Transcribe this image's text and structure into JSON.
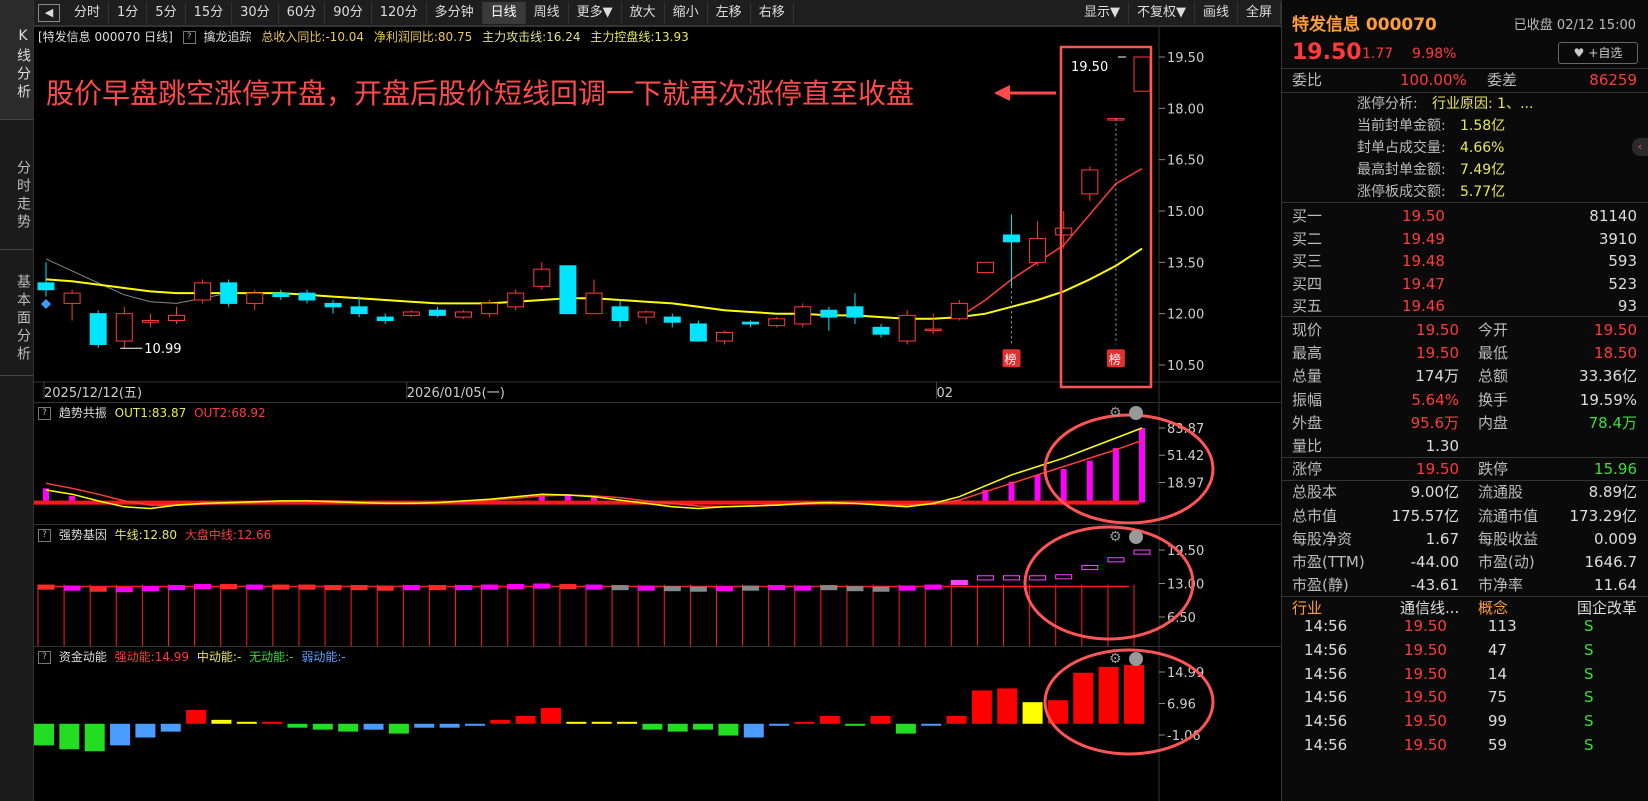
{
  "toolbar": {
    "periods": [
      "分时",
      "1分",
      "5分",
      "15分",
      "30分",
      "60分",
      "90分",
      "120分",
      "多分钟",
      "日线",
      "周线",
      "更多▼",
      "放大",
      "缩小",
      "左移",
      "右移"
    ],
    "right": [
      "显示▼",
      "不复权▼",
      "画线",
      "全屏"
    ]
  },
  "rail": {
    "k": "K线分析",
    "fs": "分时走势",
    "jb": "基本面分析"
  },
  "main_header": {
    "name": "[特发信息 000070 日线]",
    "indicator": "擒龙追踪",
    "f1": "总收入同比:-10.04",
    "f2": "净利润同比:80.75",
    "f3": "主力攻击线:16.24",
    "f4": "主力控盘线:13.93"
  },
  "annotation": {
    "text": "股价早盘跳空涨停开盘，开盘后股价短线回调一下就再次涨停直至收盘",
    "high_label": "19.50",
    "low_label": "10.99",
    "bang": "榜"
  },
  "dates": [
    "2025/12/12(五)",
    "2026/01/05(一)",
    "02"
  ],
  "main_axis": [
    "19.50",
    "18.00",
    "16.50",
    "15.00",
    "13.50",
    "12.00",
    "10.50"
  ],
  "sub1": {
    "name": "趋势共振",
    "out1": "OUT1:83.87",
    "out2": "OUT2:68.92",
    "axis": [
      "83.87",
      "51.42",
      "18.97"
    ]
  },
  "sub2": {
    "name": "强势基因",
    "l1": "牛线:12.80",
    "l2": "大盘中线:12.66",
    "axis": [
      "19.50",
      "13.00",
      "6.50"
    ]
  },
  "sub3": {
    "name": "资金动能",
    "l1": "强动能:14.99",
    "l2": "中动能:-",
    "l3": "无动能:-",
    "l4": "弱动能:-",
    "axis": [
      "14.99",
      "6.96",
      "-1.06"
    ]
  },
  "quote": {
    "title": "特发信息 000070",
    "status": "已收盘 02/12 15:00",
    "price": "19.50",
    "chg": "1.77",
    "pct": "9.98%",
    "addfav": "+自选",
    "weibi_l": "委比",
    "weibi": "100.00%",
    "weicha_l": "委差",
    "weicha": "86259",
    "limit_title": "涨停分析:",
    "limit_reason": "行业原因: 1、...",
    "limit_items": [
      [
        "当前封单金额:",
        "1.58亿"
      ],
      [
        "封单占成交量:",
        "4.66%"
      ],
      [
        "最高封单金额:",
        "7.49亿"
      ],
      [
        "涨停板成交额:",
        "5.77亿"
      ]
    ],
    "bids": [
      [
        "买一",
        "19.50",
        "81140"
      ],
      [
        "买二",
        "19.49",
        "3910"
      ],
      [
        "买三",
        "19.48",
        "593"
      ],
      [
        "买四",
        "19.47",
        "523"
      ],
      [
        "买五",
        "19.46",
        "93"
      ]
    ],
    "stats": [
      [
        "现价",
        "19.50",
        "今开",
        "19.50"
      ],
      [
        "最高",
        "19.50",
        "最低",
        "18.50"
      ],
      [
        "总量",
        "174万",
        "总额",
        "33.36亿"
      ],
      [
        "振幅",
        "5.64%",
        "换手",
        "19.59%"
      ],
      [
        "外盘",
        "95.6万",
        "内盘",
        "78.4万"
      ],
      [
        "量比",
        "1.30",
        "",
        ""
      ],
      [
        "涨停",
        "19.50",
        "跌停",
        "15.96"
      ],
      [
        "总股本",
        "9.00亿",
        "流通股",
        "8.89亿"
      ],
      [
        "总市值",
        "175.57亿",
        "流通市值",
        "173.29亿"
      ],
      [
        "每股净资",
        "1.67",
        "每股收益",
        "0.009"
      ],
      [
        "市盈(TTM)",
        "-44.00",
        "市盈(动)",
        "1646.7"
      ],
      [
        "市盈(静)",
        "-43.61",
        "市净率",
        "11.64"
      ],
      [
        "行业",
        "通信线...",
        "概念",
        "国企改革"
      ]
    ],
    "ticks": [
      [
        "14:56",
        "19.50",
        "113",
        "S"
      ],
      [
        "14:56",
        "19.50",
        "47",
        "S"
      ],
      [
        "14:56",
        "19.50",
        "14",
        "S"
      ],
      [
        "14:56",
        "19.50",
        "75",
        "S"
      ],
      [
        "14:56",
        "19.50",
        "99",
        "S"
      ],
      [
        "14:56",
        "19.50",
        "59",
        "S"
      ]
    ]
  },
  "chart_data": {
    "type": "candlestick",
    "candles": [
      {
        "o": 12.9,
        "c": 12.7,
        "h": 13.5,
        "l": 12.5
      },
      {
        "o": 12.3,
        "c": 12.6,
        "h": 12.7,
        "l": 11.8
      },
      {
        "o": 12.0,
        "c": 11.1,
        "h": 12.1,
        "l": 11.0
      },
      {
        "o": 11.2,
        "c": 12.0,
        "h": 12.2,
        "l": 10.99
      },
      {
        "o": 11.75,
        "c": 11.8,
        "h": 12.0,
        "l": 11.6
      },
      {
        "o": 11.8,
        "c": 11.95,
        "h": 12.2,
        "l": 11.7
      },
      {
        "o": 12.4,
        "c": 12.9,
        "h": 13.0,
        "l": 12.3
      },
      {
        "o": 12.9,
        "c": 12.3,
        "h": 13.0,
        "l": 12.2
      },
      {
        "o": 12.3,
        "c": 12.6,
        "h": 12.7,
        "l": 12.1
      },
      {
        "o": 12.6,
        "c": 12.5,
        "h": 12.7,
        "l": 12.4
      },
      {
        "o": 12.6,
        "c": 12.4,
        "h": 12.7,
        "l": 12.3
      },
      {
        "o": 12.3,
        "c": 12.2,
        "h": 12.4,
        "l": 12.0
      },
      {
        "o": 12.2,
        "c": 12.0,
        "h": 12.5,
        "l": 11.9
      },
      {
        "o": 11.9,
        "c": 11.8,
        "h": 12.0,
        "l": 11.7
      },
      {
        "o": 11.95,
        "c": 12.05,
        "h": 12.1,
        "l": 11.9
      },
      {
        "o": 12.1,
        "c": 11.95,
        "h": 12.2,
        "l": 11.9
      },
      {
        "o": 11.9,
        "c": 12.05,
        "h": 12.1,
        "l": 11.85
      },
      {
        "o": 12.0,
        "c": 12.3,
        "h": 12.4,
        "l": 11.9
      },
      {
        "o": 12.2,
        "c": 12.6,
        "h": 12.7,
        "l": 12.1
      },
      {
        "o": 12.8,
        "c": 13.3,
        "h": 13.5,
        "l": 12.7
      },
      {
        "o": 13.4,
        "c": 12.0,
        "h": 13.4,
        "l": 12.0
      },
      {
        "o": 12.0,
        "c": 12.6,
        "h": 13.0,
        "l": 12.0
      },
      {
        "o": 12.2,
        "c": 11.8,
        "h": 12.4,
        "l": 11.6
      },
      {
        "o": 11.9,
        "c": 12.05,
        "h": 12.1,
        "l": 11.7
      },
      {
        "o": 11.9,
        "c": 11.75,
        "h": 12.0,
        "l": 11.6
      },
      {
        "o": 11.7,
        "c": 11.2,
        "h": 11.8,
        "l": 11.2
      },
      {
        "o": 11.2,
        "c": 11.45,
        "h": 11.5,
        "l": 11.1
      },
      {
        "o": 11.75,
        "c": 11.7,
        "h": 11.8,
        "l": 11.6
      },
      {
        "o": 11.65,
        "c": 11.85,
        "h": 11.9,
        "l": 11.6
      },
      {
        "o": 11.7,
        "c": 12.2,
        "h": 12.3,
        "l": 11.6
      },
      {
        "o": 12.1,
        "c": 11.9,
        "h": 12.2,
        "l": 11.5
      },
      {
        "o": 12.2,
        "c": 11.9,
        "h": 12.6,
        "l": 11.7
      },
      {
        "o": 11.6,
        "c": 11.4,
        "h": 11.7,
        "l": 11.3
      },
      {
        "o": 11.2,
        "c": 11.95,
        "h": 12.1,
        "l": 11.1
      },
      {
        "o": 11.55,
        "c": 11.55,
        "h": 12.0,
        "l": 11.4
      },
      {
        "o": 11.85,
        "c": 12.3,
        "h": 12.4,
        "l": 11.8
      },
      {
        "o": 13.2,
        "c": 13.5,
        "h": 13.5,
        "l": 13.2
      },
      {
        "o": 14.3,
        "c": 14.1,
        "h": 14.9,
        "l": 12.8
      },
      {
        "o": 13.5,
        "c": 14.2,
        "h": 14.7,
        "l": 13.4
      },
      {
        "o": 14.3,
        "c": 14.5,
        "h": 15.0,
        "l": 13.9
      },
      {
        "o": 15.5,
        "c": 16.2,
        "h": 16.3,
        "l": 15.3
      },
      {
        "o": 17.7,
        "c": 17.7,
        "h": 17.7,
        "l": 17.7
      },
      {
        "o": 18.5,
        "c": 19.5,
        "h": 19.5,
        "l": 18.5
      }
    ],
    "ma_yellow": [
      13.0,
      12.95,
      12.85,
      12.75,
      12.65,
      12.6,
      12.6,
      12.6,
      12.6,
      12.6,
      12.55,
      12.5,
      12.45,
      12.4,
      12.35,
      12.3,
      12.3,
      12.3,
      12.35,
      12.4,
      12.45,
      12.45,
      12.4,
      12.35,
      12.3,
      12.2,
      12.1,
      12.05,
      12.0,
      12.0,
      11.95,
      11.95,
      11.9,
      11.85,
      11.85,
      11.9,
      12.0,
      12.2,
      12.4,
      12.65,
      13.0,
      13.4,
      13.9
    ],
    "ma_red": [
      null,
      null,
      null,
      null,
      null,
      null,
      null,
      null,
      null,
      null,
      null,
      null,
      null,
      null,
      null,
      null,
      null,
      null,
      null,
      null,
      null,
      null,
      null,
      null,
      null,
      null,
      null,
      null,
      null,
      null,
      null,
      null,
      null,
      null,
      null,
      11.9,
      12.4,
      13.0,
      13.5,
      14.0,
      14.9,
      15.8,
      16.24
    ],
    "sub1_bars": [
      12,
      3,
      0,
      0,
      0,
      0,
      0,
      0,
      0,
      0,
      0,
      0,
      0,
      0,
      0,
      0,
      0,
      0,
      0,
      4,
      5,
      3,
      0,
      0,
      0,
      0,
      0,
      0,
      0,
      0,
      0,
      0,
      0,
      0,
      0,
      0,
      10,
      20,
      28,
      35,
      45,
      60,
      83.87
    ],
    "sub1_out1": [
      10,
      5,
      -3,
      -10,
      -12,
      -8,
      -6,
      -5,
      -4,
      -3,
      -3,
      -4,
      -5,
      -6,
      -6,
      -5,
      -3,
      -1,
      2,
      5,
      4,
      2,
      -2,
      -6,
      -10,
      -12,
      -10,
      -9,
      -8,
      -6,
      -5,
      -6,
      -8,
      -10,
      -6,
      2,
      15,
      28,
      38,
      48,
      60,
      72,
      83.87
    ],
    "sub1_out2": [
      18,
      12,
      5,
      -3,
      -8,
      -8,
      -7,
      -6,
      -5,
      -4,
      -3,
      -3,
      -4,
      -5,
      -5,
      -5,
      -4,
      -2,
      0,
      3,
      4,
      3,
      1,
      -3,
      -6,
      -9,
      -10,
      -9,
      -8,
      -7,
      -6,
      -6,
      -7,
      -8,
      -7,
      -2,
      8,
      18,
      28,
      38,
      48,
      58,
      68.92
    ],
    "sub2_hi": [
      12.7,
      12.5,
      12.3,
      12.2,
      12.4,
      12.6,
      12.8,
      12.8,
      12.7,
      12.7,
      12.7,
      12.6,
      12.6,
      12.5,
      12.6,
      12.6,
      12.6,
      12.7,
      12.8,
      12.9,
      12.8,
      12.7,
      12.6,
      12.5,
      12.4,
      12.3,
      12.4,
      12.5,
      12.6,
      12.5,
      12.6,
      12.4,
      12.3,
      12.5,
      12.7,
      13.6,
      14.5,
      14.5,
      14.5,
      14.7,
      16.5,
      18.0,
      19.5
    ],
    "sub3_bars": [
      -5.5,
      -6.5,
      -7,
      -5.5,
      -3.5,
      -2,
      3.5,
      1,
      0.5,
      0.5,
      -1,
      -1.5,
      -2,
      -1.5,
      -2.5,
      -1,
      -1,
      -0.5,
      1,
      2,
      4,
      0.5,
      0.5,
      0.5,
      -1.5,
      -2,
      -1.5,
      -3,
      -3.5,
      -0.5,
      0.5,
      2,
      -0.5,
      2,
      -2.5,
      -0.5,
      2,
      8.5,
      9,
      5.5,
      6,
      13,
      14.5,
      14.99
    ],
    "sub3_colors": [
      "g",
      "g",
      "g",
      "b",
      "b",
      "b",
      "r",
      "y",
      "y",
      "r",
      "g",
      "g",
      "g",
      "b",
      "g",
      "b",
      "b",
      "b",
      "r",
      "r",
      "r",
      "y",
      "y",
      "y",
      "g",
      "g",
      "g",
      "g",
      "b",
      "b",
      "r",
      "r",
      "g",
      "r",
      "g",
      "b",
      "r",
      "r",
      "r",
      "y",
      "r",
      "r",
      "r",
      "r"
    ]
  }
}
